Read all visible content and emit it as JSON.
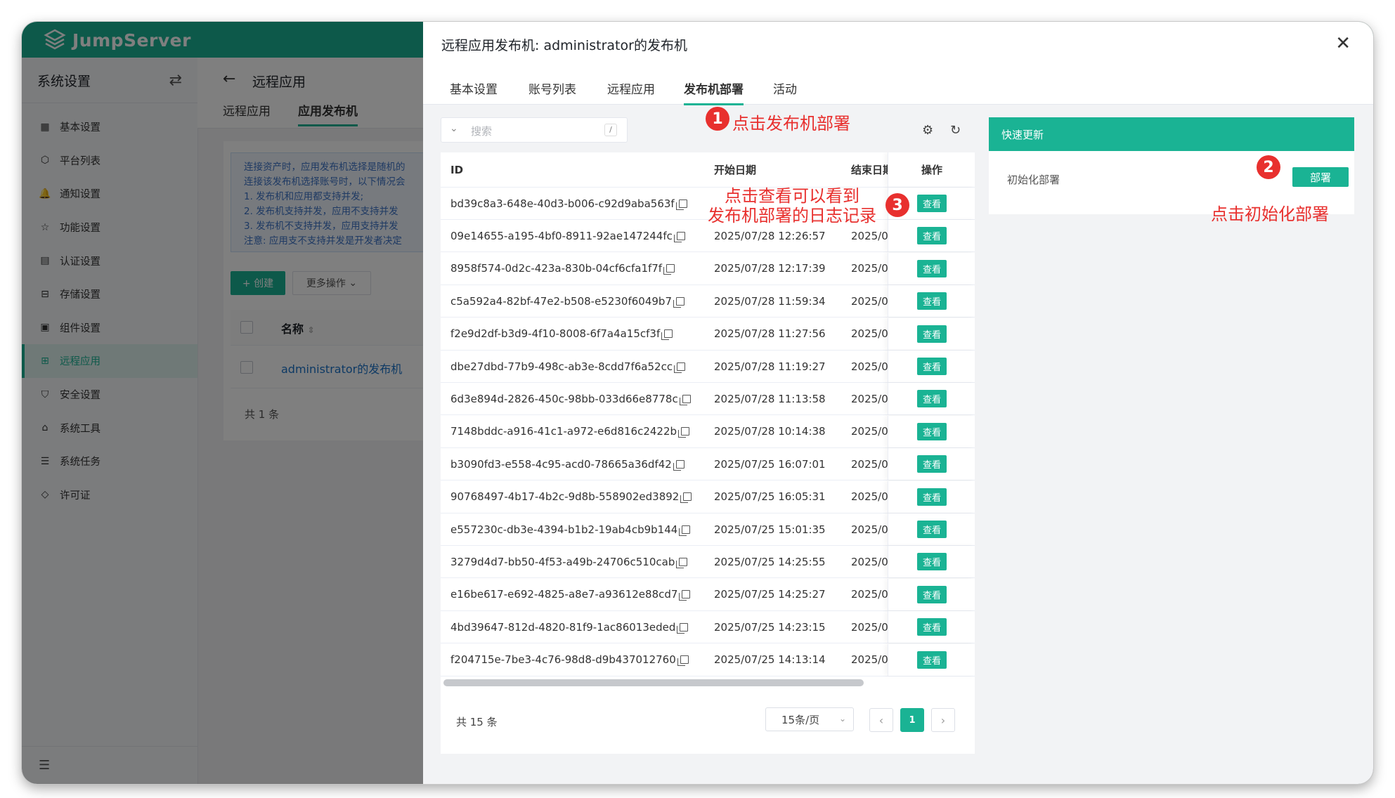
{
  "app": {
    "logo_text": "JumpServer",
    "accent_color": "#1ab394"
  },
  "sidebar": {
    "title": "系统设置",
    "items": [
      {
        "label": "基本设置",
        "icon": "grid-icon"
      },
      {
        "label": "平台列表",
        "icon": "cube-icon"
      },
      {
        "label": "通知设置",
        "icon": "bell-icon"
      },
      {
        "label": "功能设置",
        "icon": "star-icon"
      },
      {
        "label": "认证设置",
        "icon": "id-card-icon"
      },
      {
        "label": "存储设置",
        "icon": "storage-icon"
      },
      {
        "label": "组件设置",
        "icon": "monitor-icon"
      },
      {
        "label": "远程应用",
        "icon": "apps-icon",
        "active": true
      },
      {
        "label": "安全设置",
        "icon": "shield-icon"
      },
      {
        "label": "系统工具",
        "icon": "toolbox-icon"
      },
      {
        "label": "系统任务",
        "icon": "task-list-icon"
      },
      {
        "label": "许可证",
        "icon": "license-icon"
      }
    ]
  },
  "page": {
    "title": "远程应用",
    "tabs": [
      "远程应用",
      "应用发布机"
    ],
    "notice_lines": [
      "连接资产时，应用发布机选择是随机的",
      "连接该发布机选择账号时，以下情况会",
      "  1. 发布机和应用都支持并发;",
      "  2. 发布机支持并发，应用不支持并发",
      "  3. 发布机不支持并发，应用支持并发",
      "注意: 应用支不支持并发是开发者决定"
    ],
    "create_label": "+ 创建",
    "more_label": "更多操作",
    "col_name": "名称",
    "row_name": "administrator的发布机",
    "total": "共 1 条"
  },
  "drawer": {
    "title": "远程应用发布机: administrator的发布机",
    "tabs": [
      "基本设置",
      "账号列表",
      "远程应用",
      "发布机部署",
      "活动"
    ],
    "active_tab": 3,
    "search_placeholder": "搜索",
    "search_shortcut": "/",
    "table": {
      "headers": [
        "ID",
        "开始日期",
        "结束日期",
        "操作"
      ],
      "view_label": "查看",
      "rows": [
        {
          "id": "bd39c8a3-648e-40d3-b006-c92d9aba563f",
          "start": "",
          "end": ""
        },
        {
          "id": "09e14655-a195-4bf0-8911-92ae147244fc",
          "start": "2025/07/28 12:26:57",
          "end": "2025/0"
        },
        {
          "id": "8958f574-0d2c-423a-830b-04cf6cfa1f7f",
          "start": "2025/07/28 12:17:39",
          "end": "2025/0"
        },
        {
          "id": "c5a592a4-82bf-47e2-b508-e5230f6049b7",
          "start": "2025/07/28 11:59:34",
          "end": "2025/0"
        },
        {
          "id": "f2e9d2df-b3d9-4f10-8008-6f7a4a15cf3f",
          "start": "2025/07/28 11:27:56",
          "end": "2025/0"
        },
        {
          "id": "dbe27dbd-77b9-498c-ab3e-8cdd7f6a52cc",
          "start": "2025/07/28 11:19:27",
          "end": "2025/0"
        },
        {
          "id": "6d3e894d-2826-450c-98bb-033d66e8778c",
          "start": "2025/07/28 11:13:58",
          "end": "2025/0"
        },
        {
          "id": "7148bddc-a916-41c1-a972-e6d816c2422b",
          "start": "2025/07/28 10:14:38",
          "end": "2025/0"
        },
        {
          "id": "b3090fd3-e558-4c95-acd0-78665a36df42",
          "start": "2025/07/25 16:07:01",
          "end": "2025/0"
        },
        {
          "id": "90768497-4b17-4b2c-9d8b-558902ed3892",
          "start": "2025/07/25 16:05:31",
          "end": "2025/0"
        },
        {
          "id": "e557230c-db3e-4394-b1b2-19ab4cb9b144",
          "start": "2025/07/25 15:01:35",
          "end": "2025/0"
        },
        {
          "id": "3279d4d7-bb50-4f53-a49b-24706c510cab",
          "start": "2025/07/25 14:25:55",
          "end": "2025/0"
        },
        {
          "id": "e16be617-e692-4825-a8e7-a93612e88cd7",
          "start": "2025/07/25 14:25:27",
          "end": "2025/0"
        },
        {
          "id": "4bd39647-812d-4820-81f9-1ac86013eded",
          "start": "2025/07/25 14:23:15",
          "end": "2025/0"
        },
        {
          "id": "f204715e-7be3-4c76-98d8-d9b437012760",
          "start": "2025/07/25 14:13:14",
          "end": "2025/0"
        }
      ]
    },
    "pager": {
      "total": "共 15 条",
      "page_size": "15条/页",
      "current_page": "1"
    },
    "quick_update": {
      "title": "快速更新",
      "init_label": "初始化部署",
      "deploy_label": "部署"
    }
  },
  "annotations": {
    "step1_num": "1",
    "step1_text": "点击发布机部署",
    "step2_num": "2",
    "step2_text": "点击初始化部署",
    "step3_num": "3",
    "step3_line1": "点击查看可以看到",
    "step3_line2": "发布机部署的日志记录",
    "color": "#e8302e"
  }
}
